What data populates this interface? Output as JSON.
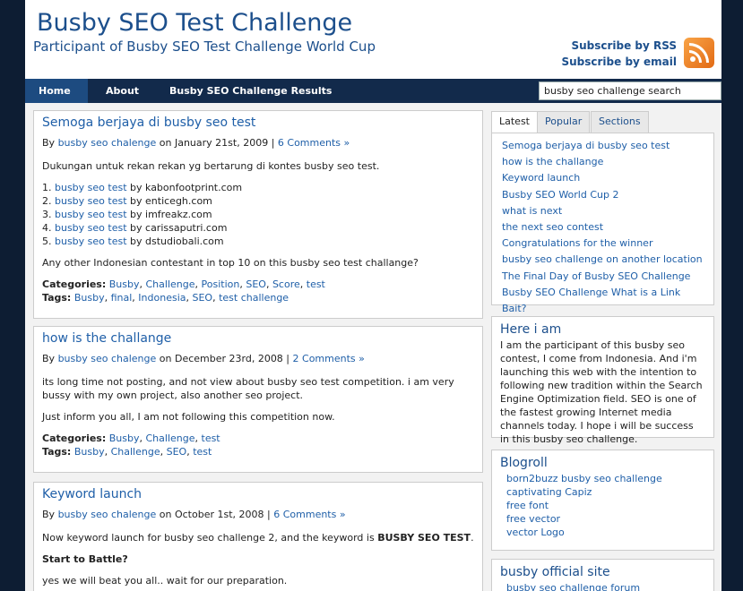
{
  "header": {
    "title": "Busby SEO Test Challenge",
    "subtitle": "Participant of Busby SEO Test Challenge World Cup",
    "subscribe_rss": "Subscribe by RSS",
    "subscribe_email": "Subscribe by email"
  },
  "nav": {
    "items": [
      "Home",
      "About",
      "Busby SEO Challenge Results"
    ],
    "search_value": "busby seo challenge search"
  },
  "posts": [
    {
      "title": "Semoga berjaya di busby seo test",
      "by": "By ",
      "author": "busby seo chalenge",
      "date": " on January 21st, 2009 | ",
      "comments": "6 Comments »",
      "body1": "Dukungan untuk rekan rekan yg bertarung di kontes busby seo test.",
      "list": [
        {
          "num": "1. ",
          "link": "busby seo test",
          "rest": " by kabonfootprint.com"
        },
        {
          "num": "2. ",
          "link": "busby seo test",
          "rest": " by enticegh.com"
        },
        {
          "num": "3. ",
          "link": "busby seo test",
          "rest": " by imfreakz.com"
        },
        {
          "num": "4. ",
          "link": "busby seo test",
          "rest": " by carissaputri.com"
        },
        {
          "num": "5. ",
          "link": "busby seo test",
          "rest": " by dstudiobali.com"
        }
      ],
      "body2": "Any other Indonesian contestant in top 10 on this busby seo test challange?",
      "categories_label": "Categories:",
      "categories": [
        "Busby",
        "Challenge",
        "Position",
        "SEO",
        "Score",
        "test"
      ],
      "tags_label": "Tags:",
      "tags": [
        "Busby",
        "final",
        "Indonesia",
        "SEO",
        "test challenge"
      ]
    },
    {
      "title": "how is the challange",
      "by": "By ",
      "author": "busby seo chalenge",
      "date": " on December 23rd, 2008 | ",
      "comments": "2 Comments »",
      "body1": "its long time not posting, and not view about busby seo test competition. i am very bussy with my own project, also another seo project.",
      "body2": "Just inform you all, I am not following this competition now.",
      "categories_label": "Categories:",
      "categories": [
        "Busby",
        "Challenge",
        "test"
      ],
      "tags_label": "Tags:",
      "tags": [
        "Busby",
        "Challenge",
        "SEO",
        "test"
      ]
    },
    {
      "title": "Keyword launch",
      "by": "By ",
      "author": "busby seo chalenge",
      "date": " on October 1st, 2008 | ",
      "comments": "6 Comments »",
      "body1_prefix": "Now keyword launch for busby seo challenge 2, and the keyword is ",
      "body1_bold": "BUSBY SEO TEST",
      "body1_suffix": ".",
      "body2": "Start to Battle?",
      "body3": "yes we will beat you all.. wait for our preparation."
    }
  ],
  "sidebar": {
    "tabs": [
      "Latest",
      "Popular",
      "Sections"
    ],
    "latest": [
      "Semoga berjaya di busby seo test",
      "how is the challange",
      "Keyword launch",
      "Busby SEO World Cup 2",
      "what is next",
      "the next seo contest",
      "Congratulations for the winner",
      "busby seo challenge on another location",
      "The Final Day of Busby SEO Challenge",
      "Busby SEO Challenge What is a Link Bait?"
    ],
    "here_title": "Here i am",
    "here_text": "I am the participant of this busby seo contest, I come from Indonesia. And i'm launching this web with the intention to following new tradition within the Search Engine Optimization field. SEO is one of the fastest growing Internet media channels today. I hope i will be success in this busby seo challenge.",
    "blogroll_title": "Blogroll",
    "blogroll": [
      "born2buzz busby seo challenge",
      "captivating Capiz",
      "free font",
      "free vector",
      "vector Logo"
    ],
    "official_title": "busby official site",
    "official": [
      "busby seo challenge forum"
    ]
  },
  "colors": {
    "accent": "#1f5fa8",
    "nav_bg": "#122a4b",
    "page_bg": "#0d1d33",
    "rss": "#f08a2c"
  }
}
